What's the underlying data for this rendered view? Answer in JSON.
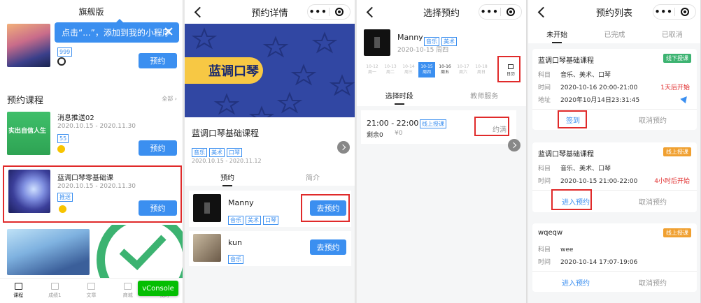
{
  "colors": {
    "accent": "#3b8ff0",
    "highlight": "#e02a2a",
    "console": "#04be02",
    "green_badge": "#3cb371",
    "orange_badge": "#f0a030",
    "banner_bg": "#3147a3",
    "banner_pill": "#f7c844"
  },
  "s1": {
    "title": "旗舰版",
    "tooltip": "点击“...”，添加到我的小程序",
    "top_tag": "999",
    "top_button": "预约",
    "section_title": "预约课程",
    "section_more": "全部 ›",
    "courses": [
      {
        "name": "消息推送02",
        "date": "2020.10.15 - 2020.11.30",
        "tag": "55",
        "button": "预约",
        "thumb_text": "实出自信人生"
      },
      {
        "name": "蓝调口琴零基础课",
        "date": "2020.10.15 - 2020.11.30",
        "tag": "推送",
        "button": "预约"
      }
    ],
    "tabbar": [
      "课程",
      "成绩1",
      "文章",
      "商城",
      "我的"
    ],
    "vconsole": "vConsole"
  },
  "s2": {
    "title": "预约详情",
    "banner_text": "蓝调口琴",
    "course_title": "蓝调口琴基础课程",
    "tags": [
      "音乐",
      "美术",
      "口琴"
    ],
    "date": "2020.10.15 - 2020.11.12",
    "tabs": [
      "预约",
      "简介"
    ],
    "teachers": [
      {
        "name": "Manny",
        "tags": [
          "音乐",
          "美术",
          "口琴"
        ],
        "button": "去预约"
      },
      {
        "name": "kun",
        "tags": [
          "音乐"
        ],
        "button": "去预约"
      }
    ]
  },
  "s3": {
    "title": "选择预约",
    "teacher_name": "Manny",
    "teacher_tags": [
      "音乐",
      "美术"
    ],
    "teacher_date": "2020-10-15 周四",
    "days": [
      {
        "d": "10-12",
        "w": "周一"
      },
      {
        "d": "10-13",
        "w": "周二"
      },
      {
        "d": "10-14",
        "w": "周三"
      },
      {
        "d": "10-15",
        "w": "周四"
      },
      {
        "d": "10-16",
        "w": "周五"
      },
      {
        "d": "10-17",
        "w": "周六"
      },
      {
        "d": "10-18",
        "w": "周日"
      }
    ],
    "calendar": "日历",
    "tabs": [
      "选择时段",
      "教师服务"
    ],
    "slot": {
      "time": "21:00 - 22:00",
      "tag": "线上授课",
      "remain": "剩余0",
      "price": "¥0",
      "status": "约满"
    }
  },
  "s4": {
    "title": "预约列表",
    "tabs": [
      "未开始",
      "已完成",
      "已取消"
    ],
    "cards": [
      {
        "title": "蓝调口琴基础课程",
        "badge": "线下授课",
        "subject_label": "科目",
        "subject": "音乐、美术、口琴",
        "time_label": "时间",
        "time": "2020-10-16 20:00-21:00",
        "hint": "1天后开始",
        "addr_label": "地址",
        "addr": "2020年10月14日23:31:45",
        "action1": "签到",
        "action2": "取消预约"
      },
      {
        "title": "蓝调口琴基础课程",
        "badge": "线上授课",
        "subject_label": "科目",
        "subject": "音乐、美术、口琴",
        "time_label": "时间",
        "time": "2020-10-15 21:00-22:00",
        "hint": "4小时后开始",
        "action1": "进入预约",
        "action2": "取消预约"
      },
      {
        "title": "wqeqw",
        "badge": "线上授课",
        "subject_label": "科目",
        "subject": "wee",
        "time_label": "时间",
        "time": "2020-10-14 17:07-19:06",
        "action1": "进入预约",
        "action2": "取消预约"
      }
    ]
  }
}
